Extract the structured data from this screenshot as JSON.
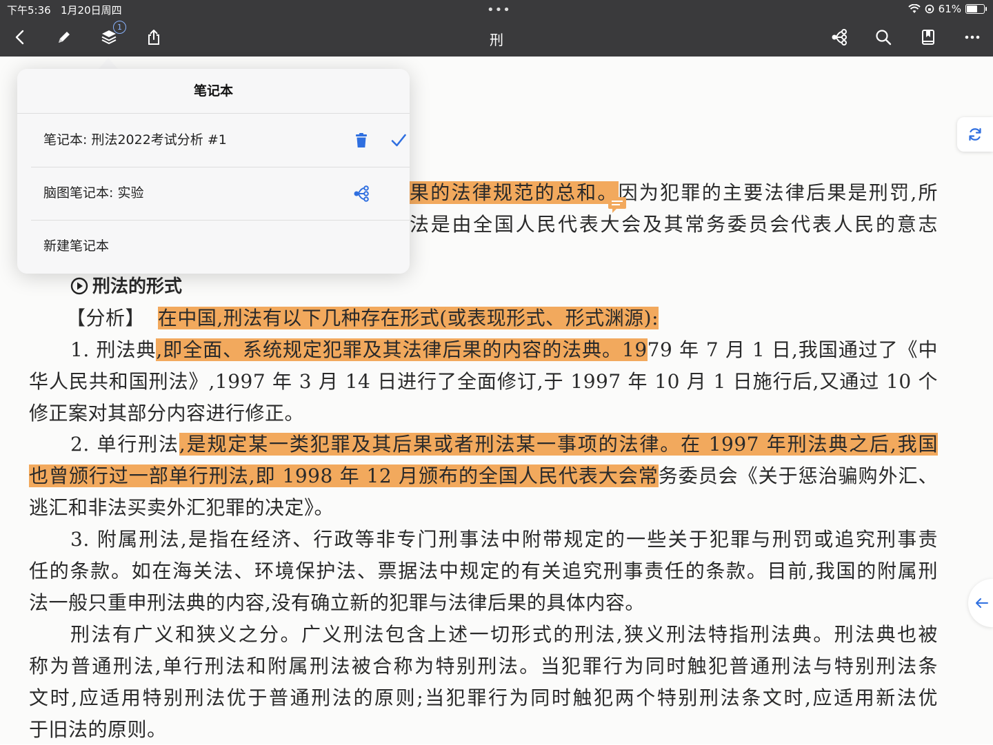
{
  "status_bar": {
    "time": "下午5:36",
    "date": "1月20日周四",
    "dots": "•••",
    "battery": "61%"
  },
  "toolbar": {
    "title": "刑",
    "layers_badge": "1",
    "icons": [
      "back-icon",
      "pencil-icon",
      "layers-icon",
      "share-icon",
      "mindmap-icon",
      "search-icon",
      "bookmark-icon",
      "more-icon"
    ]
  },
  "popover": {
    "title": "笔记本",
    "items": [
      {
        "label": "笔记本: 刑法2022考试分析 #1",
        "icons": [
          "trash-icon",
          "checkmark-icon"
        ]
      },
      {
        "label": "脑图笔记本: 实验",
        "icons": [
          "mindmap-icon"
        ]
      },
      {
        "label": "新建笔记本",
        "icons": []
      }
    ]
  },
  "document": {
    "frag1_hl": "果的法律规范的总和。",
    "frag1_rest": "因为犯罪的主要法律后果是刑罚,所",
    "frag2": "法是由全国人民代表大会及其常务委员会代表人民的意志",
    "section_title": "刑法的形式",
    "analysis_label": "【分析】",
    "analysis_hl": "在中国,刑法有以下几种存在形式(或表现形式、形式渊源):",
    "p1_lead": "1. 刑法典",
    "p1_hl": ",即全面、系统规定犯罪及其法律后果的内容的法典。19",
    "p1_rest": "79 年 7 月 1 日,我国通过了《中",
    "p1_l2": "华人民共和国刑法》,1997 年 3 月 14 日进行了全面修订,于 1997 年 10 月 1 日施行后,又通过 10 个",
    "p1_l3": "修正案对其部分内容进行修正。",
    "p2_lead": "2. 单行刑法",
    "p2_hl1": ",是规定某一类犯罪及其后果或者刑法某一事项的法律。在 1997 年刑法典之后,我国",
    "p2_hl2": "也曾颁行过一部单行刑法,即 1998 年 12 月颁布的全国人民代表大会常",
    "p2_rest2": "务委员会《关于惩治骗购外汇、",
    "p2_l3": "逃汇和非法买卖外汇犯罪的决定》。",
    "p3_l1": "3. 附属刑法,是指在经济、行政等非专门刑事法中附带规定的一些关于犯罪与刑罚或追究刑事责",
    "p3_l2": "任的条款。如在海关法、环境保护法、票据法中规定的有关追究刑事责任的条款。目前,我国的附属刑",
    "p3_l3": "法一般只重申刑法典的内容,没有确立新的犯罪与法律后果的具体内容。",
    "p4_l1": "刑法有广义和狭义之分。广义刑法包含上述一切形式的刑法,狭义刑法特指刑法典。刑法典也被",
    "p4_l2": "称为普通刑法,单行刑法和附属刑法被合称为特别刑法。当犯罪行为同时触犯普通刑法与特别刑法条",
    "p4_l3": "文时,应适用特别刑法优于普通刑法的原则;当犯罪行为同时触犯两个特别刑法条文时,应适用新法优",
    "p4_l4": "于旧法的原则。"
  },
  "colors": {
    "toolbar_bg": "#3a3a3c",
    "highlight": "#f2a95d",
    "accent_blue": "#2f6fe0"
  }
}
